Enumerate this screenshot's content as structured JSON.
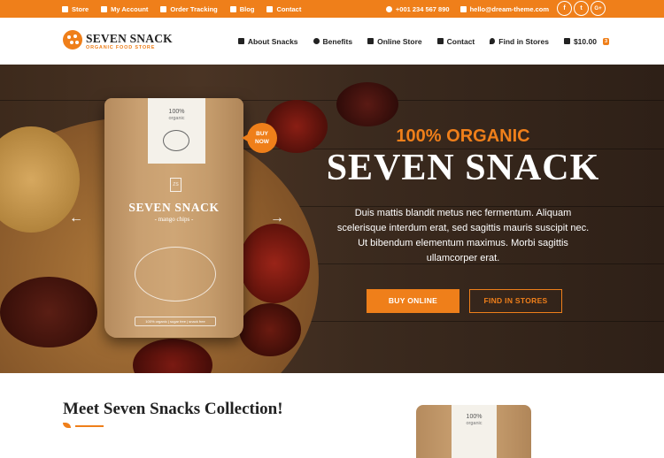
{
  "topbar": {
    "links": [
      {
        "label": "Store",
        "icon": "store-icon"
      },
      {
        "label": "My Account",
        "icon": "lock-icon"
      },
      {
        "label": "Order Tracking",
        "icon": "truck-icon"
      },
      {
        "label": "Blog",
        "icon": "document-icon"
      },
      {
        "label": "Contact",
        "icon": "envelope-icon"
      }
    ],
    "phone": "+001 234 567 890",
    "email": "hello@dream-theme.com",
    "social": [
      "f",
      "t",
      "G+"
    ]
  },
  "header": {
    "brand": "SEVEN SNACK",
    "tagline": "ORGANIC FOOD STORE",
    "nav": [
      {
        "label": "About Snacks",
        "icon": "utensils-icon"
      },
      {
        "label": "Benefits",
        "icon": "star-icon"
      },
      {
        "label": "Online Store",
        "icon": "basket-icon"
      },
      {
        "label": "Contact",
        "icon": "envelope-icon"
      },
      {
        "label": "Find in Stores",
        "icon": "map-pin-icon"
      }
    ],
    "cart_total": "$10.00",
    "cart_count": "3"
  },
  "hero": {
    "product": {
      "label_line1": "100%",
      "label_line2": "organic",
      "monogram": "ZS",
      "name": "SEVEN SNACK",
      "subtitle": "- mango chips -",
      "footer": "100% organic | sugar free | snack free"
    },
    "badge": "BUY NOW",
    "prev_arrow": "←",
    "next_arrow": "→",
    "kicker": "100% ORGANIC",
    "title": "SEVEN SNACK",
    "description": "Duis mattis blandit metus nec fermentum. Aliquam scelerisque interdum erat, sed sagittis mauris suscipit nec. Ut bibendum elementum maximus. Morbi sagittis ullamcorper erat.",
    "buttons": {
      "primary": "BUY ONLINE",
      "secondary": "FIND IN STORES"
    }
  },
  "section": {
    "title": "Meet Seven Snacks Collection!",
    "product_label_line1": "100%",
    "product_label_line2": "organic"
  },
  "colors": {
    "accent": "#ef7f1a",
    "dark": "#222222"
  }
}
